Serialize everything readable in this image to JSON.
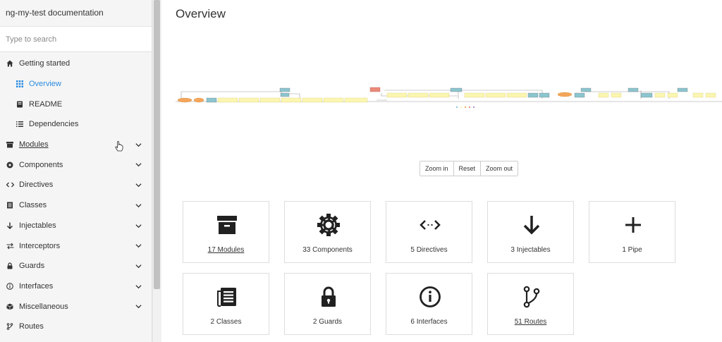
{
  "sidebar": {
    "brand": "ng-my-test documentation",
    "search_placeholder": "Type to search",
    "items": [
      {
        "label": "Getting started",
        "icon": "home-icon"
      },
      {
        "label": "Overview",
        "icon": "grid-icon"
      },
      {
        "label": "README",
        "icon": "book-icon"
      },
      {
        "label": "Dependencies",
        "icon": "list-icon"
      },
      {
        "label": "Modules",
        "icon": "archive-icon"
      },
      {
        "label": "Components",
        "icon": "cog-icon"
      },
      {
        "label": "Directives",
        "icon": "code-icon"
      },
      {
        "label": "Classes",
        "icon": "file-icon"
      },
      {
        "label": "Injectables",
        "icon": "arrow-down-icon"
      },
      {
        "label": "Interceptors",
        "icon": "swap-icon"
      },
      {
        "label": "Guards",
        "icon": "lock-icon"
      },
      {
        "label": "Interfaces",
        "icon": "info-icon"
      },
      {
        "label": "Miscellaneous",
        "icon": "cube-icon"
      },
      {
        "label": "Routes",
        "icon": "routes-icon"
      }
    ]
  },
  "main": {
    "title": "Overview",
    "zoom": {
      "zoom_in": "Zoom in",
      "reset": "Reset",
      "zoom_out": "Zoom out"
    },
    "cards": [
      {
        "label": "17 Modules",
        "icon": "archive-icon"
      },
      {
        "label": "33 Components",
        "icon": "cog-icon"
      },
      {
        "label": "5 Directives",
        "icon": "code-icon"
      },
      {
        "label": "3 Injectables",
        "icon": "arrow-down-icon"
      },
      {
        "label": "1 Pipe",
        "icon": "plus-icon"
      },
      {
        "label": "2 Classes",
        "icon": "file-icon"
      },
      {
        "label": "2 Guards",
        "icon": "lock-icon"
      },
      {
        "label": "6 Interfaces",
        "icon": "info-icon"
      },
      {
        "label": "51 Routes",
        "icon": "routes-icon"
      }
    ]
  },
  "colors": {
    "accent": "#2a8be0",
    "sidebar_bg": "#f5f5f5",
    "text": "#333333"
  }
}
